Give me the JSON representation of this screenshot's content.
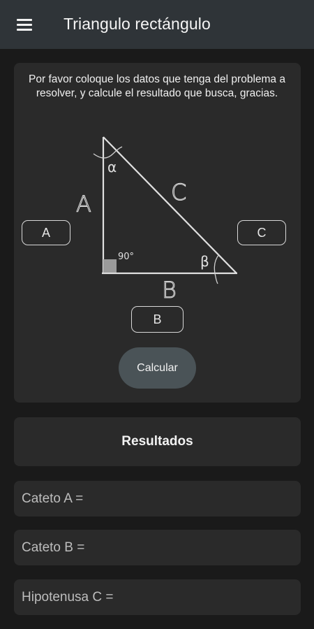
{
  "appbar": {
    "title": "Triangulo rectángulo",
    "menu_icon": "hamburger-menu-icon"
  },
  "instructions": "Por favor coloque los datos que tenga del problema a resolver, y calcule el resultado que busca, gracias.",
  "diagram": {
    "label_a": "A",
    "label_b": "B",
    "label_c": "C",
    "angle_alpha": "α",
    "angle_beta": "β",
    "right_angle": "90°"
  },
  "inputs": {
    "a_placeholder": "A",
    "b_placeholder": "B",
    "c_placeholder": "C"
  },
  "calculate_label": "Calcular",
  "results": {
    "title": "Resultados",
    "cateto_a": "Cateto A =",
    "cateto_b": "Cateto B =",
    "hipotenusa_c": "Hipotenusa C ="
  },
  "colors": {
    "appbar": "#2f3438",
    "background": "#1a1a1a",
    "card": "#2a2a2a",
    "button": "#4a5357"
  }
}
